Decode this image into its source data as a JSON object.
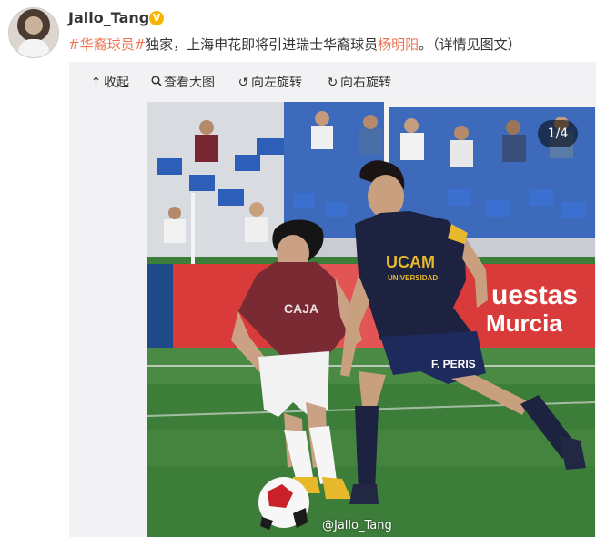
{
  "post": {
    "username": "Jallo_Tang",
    "verified_badge": "V",
    "hashtag": "#华裔球员#",
    "text_before_name": "独家，上海申花即将引进瑞士华裔球员",
    "highlight_name": "杨明阳",
    "text_after_name": "。（详情见图文）"
  },
  "viewer_toolbar": {
    "collapse_label": "收起",
    "view_large_label": "查看大图",
    "rotate_left_label": "向左旋转",
    "rotate_right_label": "向右旋转"
  },
  "photo": {
    "counter": "1/4",
    "watermark": "@Jallo_Tang",
    "ad_boards": [
      "uestas",
      "Murcia"
    ],
    "player_right_shirt_text": [
      "UCAM",
      "UNIVERSIDAD"
    ],
    "player_right_shorts_text": "F. PERIS",
    "player_left_shirt_text": "CAJA"
  },
  "colors": {
    "link_orange": "#eb7350",
    "pitch_green": "#3d7d3a",
    "maroon_kit": "#7a2a33",
    "navy_kit": "#1d2240",
    "yellow_trim": "#e8b92c"
  }
}
